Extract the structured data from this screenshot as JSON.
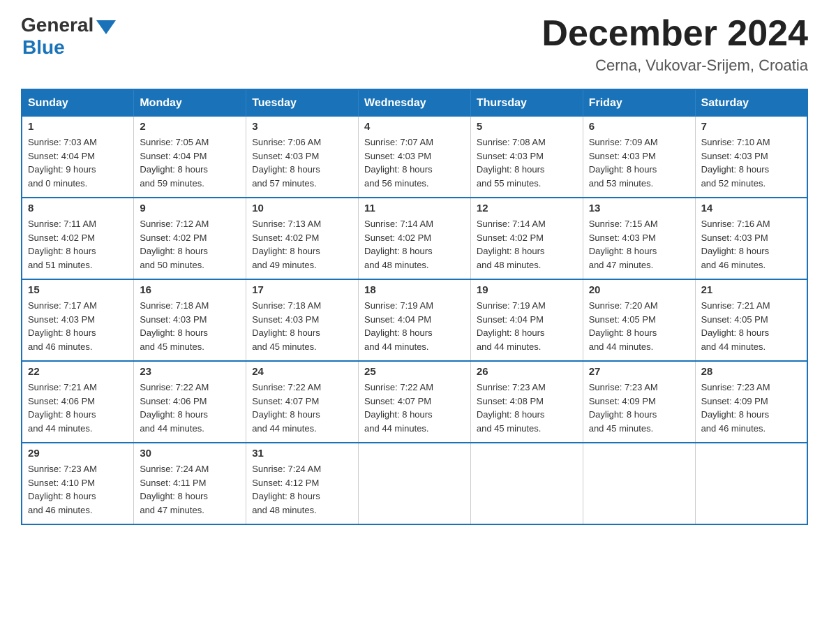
{
  "header": {
    "logo_general": "General",
    "logo_blue": "Blue",
    "month_title": "December 2024",
    "location": "Cerna, Vukovar-Srijem, Croatia"
  },
  "weekdays": [
    "Sunday",
    "Monday",
    "Tuesday",
    "Wednesday",
    "Thursday",
    "Friday",
    "Saturday"
  ],
  "weeks": [
    [
      {
        "day": "1",
        "sunrise": "7:03 AM",
        "sunset": "4:04 PM",
        "daylight": "9 hours and 0 minutes."
      },
      {
        "day": "2",
        "sunrise": "7:05 AM",
        "sunset": "4:04 PM",
        "daylight": "8 hours and 59 minutes."
      },
      {
        "day": "3",
        "sunrise": "7:06 AM",
        "sunset": "4:03 PM",
        "daylight": "8 hours and 57 minutes."
      },
      {
        "day": "4",
        "sunrise": "7:07 AM",
        "sunset": "4:03 PM",
        "daylight": "8 hours and 56 minutes."
      },
      {
        "day": "5",
        "sunrise": "7:08 AM",
        "sunset": "4:03 PM",
        "daylight": "8 hours and 55 minutes."
      },
      {
        "day": "6",
        "sunrise": "7:09 AM",
        "sunset": "4:03 PM",
        "daylight": "8 hours and 53 minutes."
      },
      {
        "day": "7",
        "sunrise": "7:10 AM",
        "sunset": "4:03 PM",
        "daylight": "8 hours and 52 minutes."
      }
    ],
    [
      {
        "day": "8",
        "sunrise": "7:11 AM",
        "sunset": "4:02 PM",
        "daylight": "8 hours and 51 minutes."
      },
      {
        "day": "9",
        "sunrise": "7:12 AM",
        "sunset": "4:02 PM",
        "daylight": "8 hours and 50 minutes."
      },
      {
        "day": "10",
        "sunrise": "7:13 AM",
        "sunset": "4:02 PM",
        "daylight": "8 hours and 49 minutes."
      },
      {
        "day": "11",
        "sunrise": "7:14 AM",
        "sunset": "4:02 PM",
        "daylight": "8 hours and 48 minutes."
      },
      {
        "day": "12",
        "sunrise": "7:14 AM",
        "sunset": "4:02 PM",
        "daylight": "8 hours and 48 minutes."
      },
      {
        "day": "13",
        "sunrise": "7:15 AM",
        "sunset": "4:03 PM",
        "daylight": "8 hours and 47 minutes."
      },
      {
        "day": "14",
        "sunrise": "7:16 AM",
        "sunset": "4:03 PM",
        "daylight": "8 hours and 46 minutes."
      }
    ],
    [
      {
        "day": "15",
        "sunrise": "7:17 AM",
        "sunset": "4:03 PM",
        "daylight": "8 hours and 46 minutes."
      },
      {
        "day": "16",
        "sunrise": "7:18 AM",
        "sunset": "4:03 PM",
        "daylight": "8 hours and 45 minutes."
      },
      {
        "day": "17",
        "sunrise": "7:18 AM",
        "sunset": "4:03 PM",
        "daylight": "8 hours and 45 minutes."
      },
      {
        "day": "18",
        "sunrise": "7:19 AM",
        "sunset": "4:04 PM",
        "daylight": "8 hours and 44 minutes."
      },
      {
        "day": "19",
        "sunrise": "7:19 AM",
        "sunset": "4:04 PM",
        "daylight": "8 hours and 44 minutes."
      },
      {
        "day": "20",
        "sunrise": "7:20 AM",
        "sunset": "4:05 PM",
        "daylight": "8 hours and 44 minutes."
      },
      {
        "day": "21",
        "sunrise": "7:21 AM",
        "sunset": "4:05 PM",
        "daylight": "8 hours and 44 minutes."
      }
    ],
    [
      {
        "day": "22",
        "sunrise": "7:21 AM",
        "sunset": "4:06 PM",
        "daylight": "8 hours and 44 minutes."
      },
      {
        "day": "23",
        "sunrise": "7:22 AM",
        "sunset": "4:06 PM",
        "daylight": "8 hours and 44 minutes."
      },
      {
        "day": "24",
        "sunrise": "7:22 AM",
        "sunset": "4:07 PM",
        "daylight": "8 hours and 44 minutes."
      },
      {
        "day": "25",
        "sunrise": "7:22 AM",
        "sunset": "4:07 PM",
        "daylight": "8 hours and 44 minutes."
      },
      {
        "day": "26",
        "sunrise": "7:23 AM",
        "sunset": "4:08 PM",
        "daylight": "8 hours and 45 minutes."
      },
      {
        "day": "27",
        "sunrise": "7:23 AM",
        "sunset": "4:09 PM",
        "daylight": "8 hours and 45 minutes."
      },
      {
        "day": "28",
        "sunrise": "7:23 AM",
        "sunset": "4:09 PM",
        "daylight": "8 hours and 46 minutes."
      }
    ],
    [
      {
        "day": "29",
        "sunrise": "7:23 AM",
        "sunset": "4:10 PM",
        "daylight": "8 hours and 46 minutes."
      },
      {
        "day": "30",
        "sunrise": "7:24 AM",
        "sunset": "4:11 PM",
        "daylight": "8 hours and 47 minutes."
      },
      {
        "day": "31",
        "sunrise": "7:24 AM",
        "sunset": "4:12 PM",
        "daylight": "8 hours and 48 minutes."
      },
      null,
      null,
      null,
      null
    ]
  ],
  "labels": {
    "sunrise": "Sunrise:",
    "sunset": "Sunset:",
    "daylight": "Daylight:"
  }
}
